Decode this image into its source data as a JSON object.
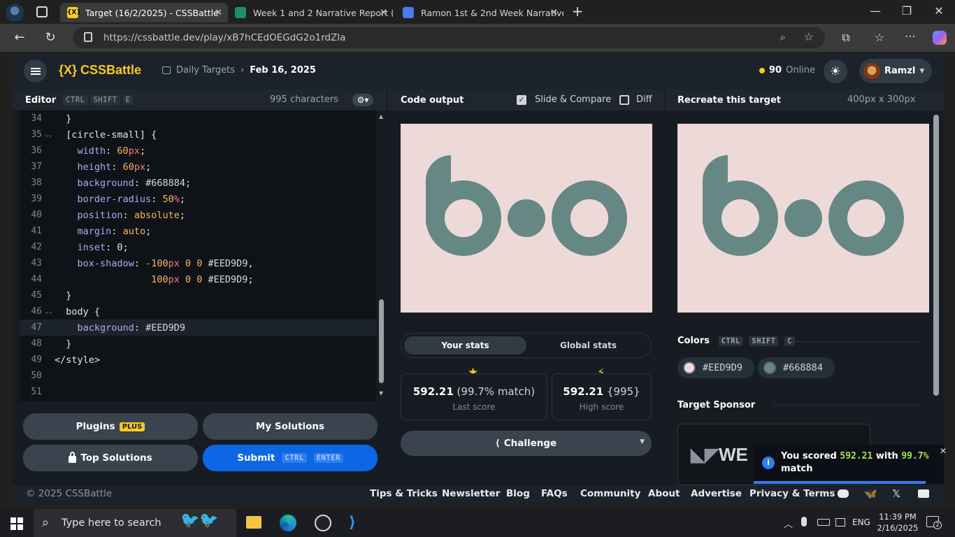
{
  "browser": {
    "tabs": [
      {
        "title": "Target (16/2/2025) - CSSBattle",
        "active": true
      },
      {
        "title": "Week 1 and 2 Narrative Report (Fo",
        "active": false
      },
      {
        "title": "Ramon 1st & 2nd Week Narrative",
        "active": false
      }
    ],
    "url": "https://cssbattle.dev/play/xB7hCEdOEGdG2o1rdZla"
  },
  "nav": {
    "logo": "{X} CSSBattle",
    "breadcrumb_section": "Daily Targets",
    "breadcrumb_date": "Feb 16, 2025",
    "online_count": "90",
    "online_label": "Online",
    "username": "Ramzl"
  },
  "editor": {
    "title": "Editor",
    "shortcut": [
      "CTRL",
      "SHIFT",
      "E"
    ],
    "char_count": "995 characters",
    "lines": [
      {
        "num": "34",
        "text": "  }"
      },
      {
        "num": "35",
        "text": "  [circle-small] {"
      },
      {
        "num": "36",
        "text": "    width: 60px;"
      },
      {
        "num": "37",
        "text": "    height: 60px;"
      },
      {
        "num": "38",
        "text": "    background: #668884;"
      },
      {
        "num": "39",
        "text": "    border-radius: 50%;"
      },
      {
        "num": "40",
        "text": "    position: absolute;"
      },
      {
        "num": "41",
        "text": "    margin: auto;"
      },
      {
        "num": "42",
        "text": "    inset: 0;"
      },
      {
        "num": "43",
        "text": "    box-shadow: -100px 0 0 #EED9D9,"
      },
      {
        "num": "44",
        "text": "                 100px 0 0 #EED9D9;"
      },
      {
        "num": "45",
        "text": "  }"
      },
      {
        "num": "46",
        "text": "  body {"
      },
      {
        "num": "47",
        "text": "    background: #EED9D9"
      },
      {
        "num": "48",
        "text": "  }"
      },
      {
        "num": "49",
        "text": "</style>"
      },
      {
        "num": "50",
        "text": ""
      },
      {
        "num": "51",
        "text": ""
      }
    ]
  },
  "buttons": {
    "plugins": "Plugins",
    "plus_badge": "PLUS",
    "my_solutions": "My Solutions",
    "top_solutions": "Top Solutions",
    "submit": "Submit",
    "submit_keys": [
      "CTRL",
      "ENTER"
    ]
  },
  "output": {
    "title": "Code output",
    "slide_compare": "Slide & Compare",
    "slide_compare_checked": true,
    "diff": "Diff",
    "diff_checked": false,
    "tabs": [
      "Your stats",
      "Global stats"
    ],
    "last_score_value": "592.21",
    "last_score_match": "(99.7% match)",
    "last_score_label": "Last score",
    "high_score_value": "592.21",
    "high_score_chars": "{995}",
    "high_score_label": "High score",
    "challenge": "Challenge"
  },
  "target": {
    "title": "Recreate this target",
    "size": "400px x 300px",
    "colors_label": "Colors",
    "colors_shortcut": [
      "CTRL",
      "SHIFT",
      "C"
    ],
    "colors": [
      {
        "hex": "#EED9D9",
        "value": "#EED9D9"
      },
      {
        "hex": "#668884",
        "value": "#668884"
      }
    ],
    "sponsor_label": "Target Sponsor",
    "sponsor_text": "WE"
  },
  "toast": {
    "prefix": "You scored",
    "score": "592.21",
    "mid": "with",
    "match": "99.7%",
    "suffix": "match"
  },
  "footer": {
    "copyright": "© 2025 CSSBattle",
    "links": [
      "Tips & Tricks",
      "Newsletter",
      "Blog",
      "FAQs",
      "Community",
      "About",
      "Advertise",
      "Privacy & Terms"
    ]
  },
  "taskbar": {
    "search_placeholder": "Type here to search",
    "language": "ENG",
    "time": "11:39 PM",
    "date": "2/16/2025",
    "notifications": "2"
  },
  "colors": {
    "accent": "#f9c924",
    "shape": "#668884",
    "canvas_bg": "#EED9D9",
    "submit_blue": "#0d66e4"
  }
}
